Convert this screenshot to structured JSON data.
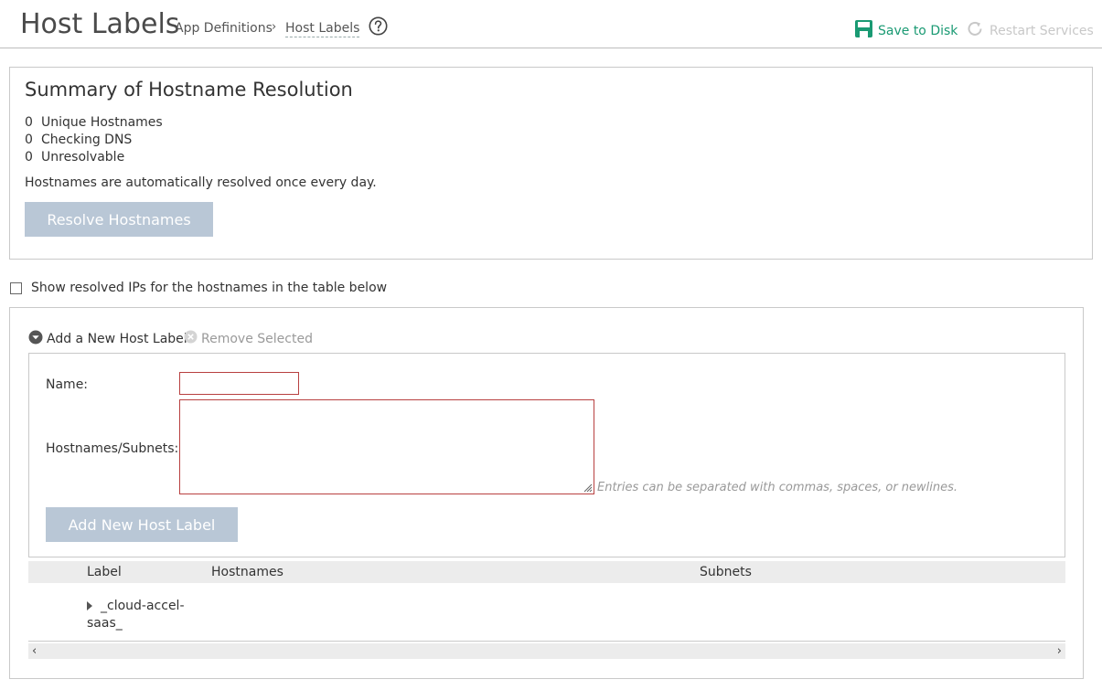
{
  "header": {
    "title": "Host Labels",
    "breadcrumb": [
      "App Definitions",
      "Host Labels"
    ],
    "breadcrumb_separator": "›",
    "actions": {
      "save_label": "Save to Disk",
      "restart_label": "Restart Services"
    }
  },
  "colors": {
    "accent_green": "#1a9a73",
    "disabled_button": "#b9c7d6",
    "invalid_border": "#b84040"
  },
  "summary": {
    "title": "Summary of Hostname Resolution",
    "stats": [
      {
        "count": "0",
        "label": "Unique Hostnames"
      },
      {
        "count": "0",
        "label": "Checking DNS"
      },
      {
        "count": "0",
        "label": "Unresolvable"
      }
    ],
    "note": "Hostnames are automatically resolved once every day.",
    "resolve_button": "Resolve Hostnames"
  },
  "show_ips": {
    "label": "Show resolved IPs for the hostnames in the table below",
    "checked": false
  },
  "toolbar": {
    "add_label": "Add a New Host Label",
    "remove_label": "Remove Selected"
  },
  "form": {
    "name_label": "Name:",
    "name_value": "",
    "hosts_label": "Hostnames/Subnets:",
    "hosts_value": "",
    "hosts_hint": "Entries can be separated with commas, spaces, or newlines.",
    "submit_label": "Add New Host Label"
  },
  "table": {
    "columns": [
      "Label",
      "Hostnames",
      "Subnets"
    ],
    "rows": [
      {
        "label": "_cloud-accel-saas_",
        "hostnames": "",
        "subnets": ""
      }
    ]
  },
  "icons": {
    "help": "help-circle-icon",
    "save": "floppy-disk-icon",
    "restart": "refresh-icon",
    "add_toggle": "chevron-down-circle-icon",
    "remove": "x-circle-icon",
    "expand": "caret-right-icon"
  }
}
